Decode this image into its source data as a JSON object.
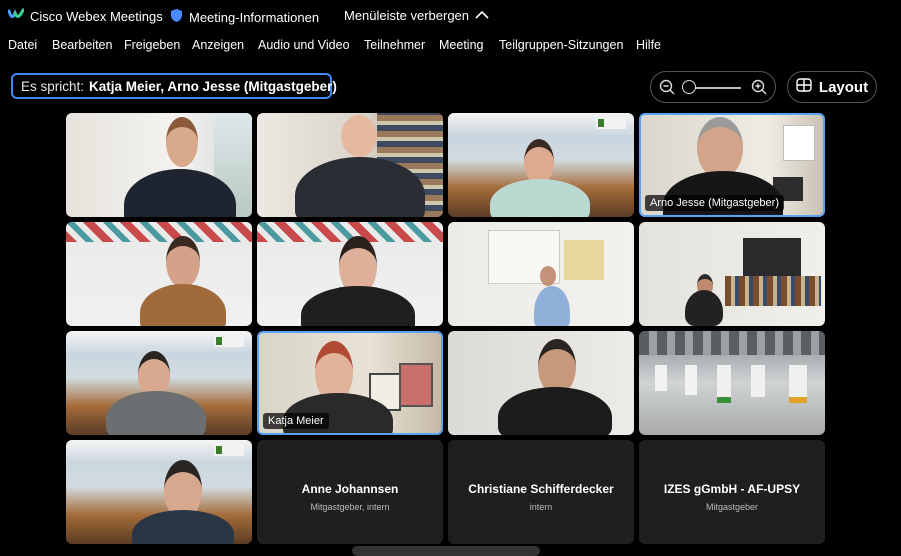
{
  "titlebar": {
    "app_name": "Cisco Webex Meetings",
    "meeting_info": "Meeting-Informationen",
    "hide_menu": "Menüleiste verbergen"
  },
  "menu": [
    "Datei",
    "Bearbeiten",
    "Freigeben",
    "Anzeigen",
    "Audio und Video",
    "Teilnehmer",
    "Meeting",
    "Teilgruppen-Sitzungen",
    "Hilfe"
  ],
  "speaker": {
    "label": "Es spricht:",
    "names": "Katja Meier, Arno Jesse (Mitgastgeber)"
  },
  "toolbar": {
    "layout_label": "Layout"
  },
  "tiles": {
    "arno": {
      "name": "Arno Jesse (Mitgastgeber)"
    },
    "katja": {
      "name": "Katja Meier"
    },
    "anne": {
      "name": "Anne Johannsen",
      "role": "Mitgastgeber, intern"
    },
    "christiane": {
      "name": "Christiane Schifferdecker",
      "role": "intern"
    },
    "izes": {
      "name": "IZES gGmbH - AF-UPSY",
      "role": "Mitgastgeber"
    }
  },
  "colors": {
    "accent": "#3d8af7",
    "active_border": "#5aa4f5",
    "tile_bg": "#1f1f1f",
    "background": "#000000"
  }
}
